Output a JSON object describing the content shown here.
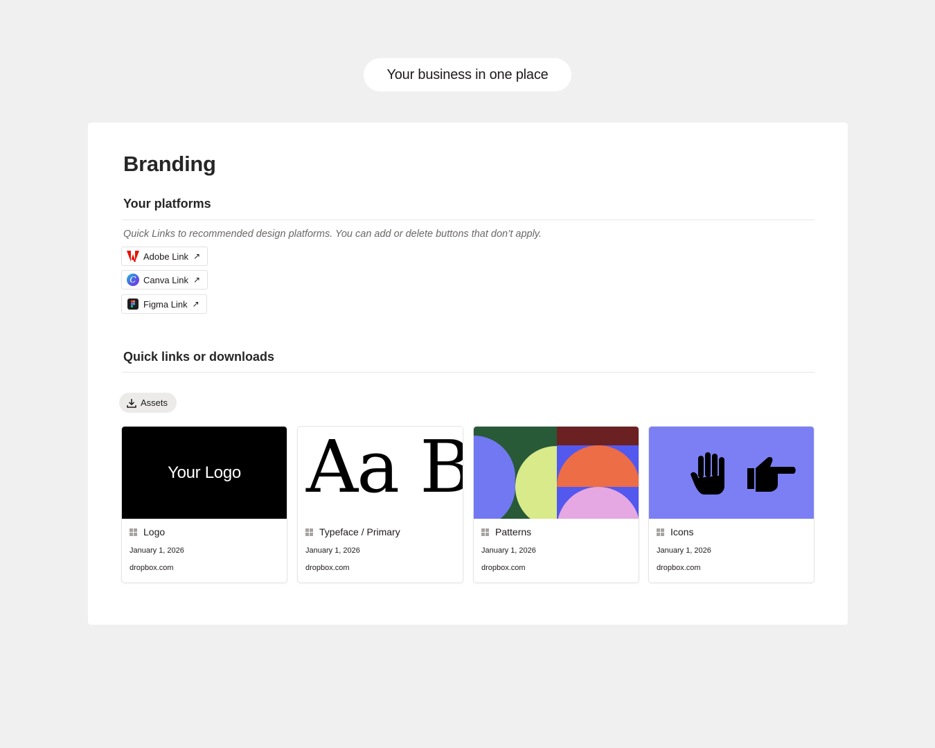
{
  "banner": {
    "label": "Your business in one place"
  },
  "page": {
    "title": "Branding",
    "platforms": {
      "heading": "Your platforms",
      "hint": "Quick Links to recommended design platforms. You can add or delete buttons that don’t apply.",
      "links": [
        {
          "label": "Adobe Link",
          "icon": "adobe-icon",
          "arrow": "↗"
        },
        {
          "label": "Canva Link",
          "icon": "canva-icon",
          "arrow": "↗"
        },
        {
          "label": "Figma Link",
          "icon": "figma-icon",
          "arrow": "↗"
        }
      ]
    },
    "downloads": {
      "heading": "Quick links or downloads",
      "assets_label": "Assets",
      "assets_icon": "download-icon",
      "tiles": [
        {
          "thumb_text": "Your Logo",
          "name": "Logo",
          "date": "January 1, 2026",
          "source": "dropbox.com"
        },
        {
          "thumb_text": "Aa B",
          "name": "Typeface / Primary",
          "date": "January 1, 2026",
          "source": "dropbox.com"
        },
        {
          "name": "Patterns",
          "date": "January 1, 2026",
          "source": "dropbox.com"
        },
        {
          "name": "Icons",
          "date": "January 1, 2026",
          "source": "dropbox.com",
          "thumb_icons": [
            "raised-hand-icon",
            "pointing-hand-icon"
          ]
        }
      ]
    }
  },
  "colors": {
    "background": "#f0f0f0",
    "card": "#ffffff",
    "icons_tile_bg": "#7b7ff3",
    "pattern_green": "#285a38",
    "pattern_maroon": "#6b2022",
    "pattern_blue": "#5358ee",
    "pattern_periwinkle": "#7278f1",
    "pattern_lime": "#d8ea8a",
    "pattern_orange": "#ec6d46",
    "pattern_pink": "#e6a8e2"
  }
}
